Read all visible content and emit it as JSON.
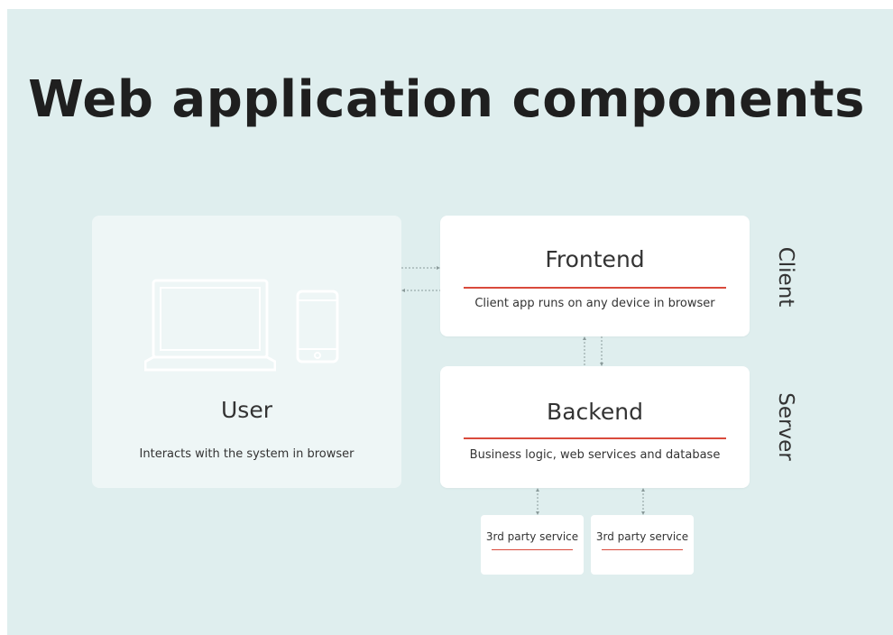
{
  "title": "Web application components",
  "user": {
    "title": "User",
    "description": "Interacts with the system in browser"
  },
  "frontend": {
    "title": "Frontend",
    "description": "Client app runs on any device in browser"
  },
  "backend": {
    "title": "Backend",
    "description": "Business logic, web services and database"
  },
  "layers": {
    "client": "Client",
    "server": "Server"
  },
  "third_party": [
    {
      "label": "3rd party service"
    },
    {
      "label": "3rd party service"
    }
  ],
  "colors": {
    "background": "#dfeeee",
    "card": "#ffffff",
    "user_card": "#eef6f6",
    "accent_line": "#d94a3c",
    "connector": "#8a9a9a"
  },
  "icons": [
    "laptop-icon",
    "smartphone-icon"
  ]
}
